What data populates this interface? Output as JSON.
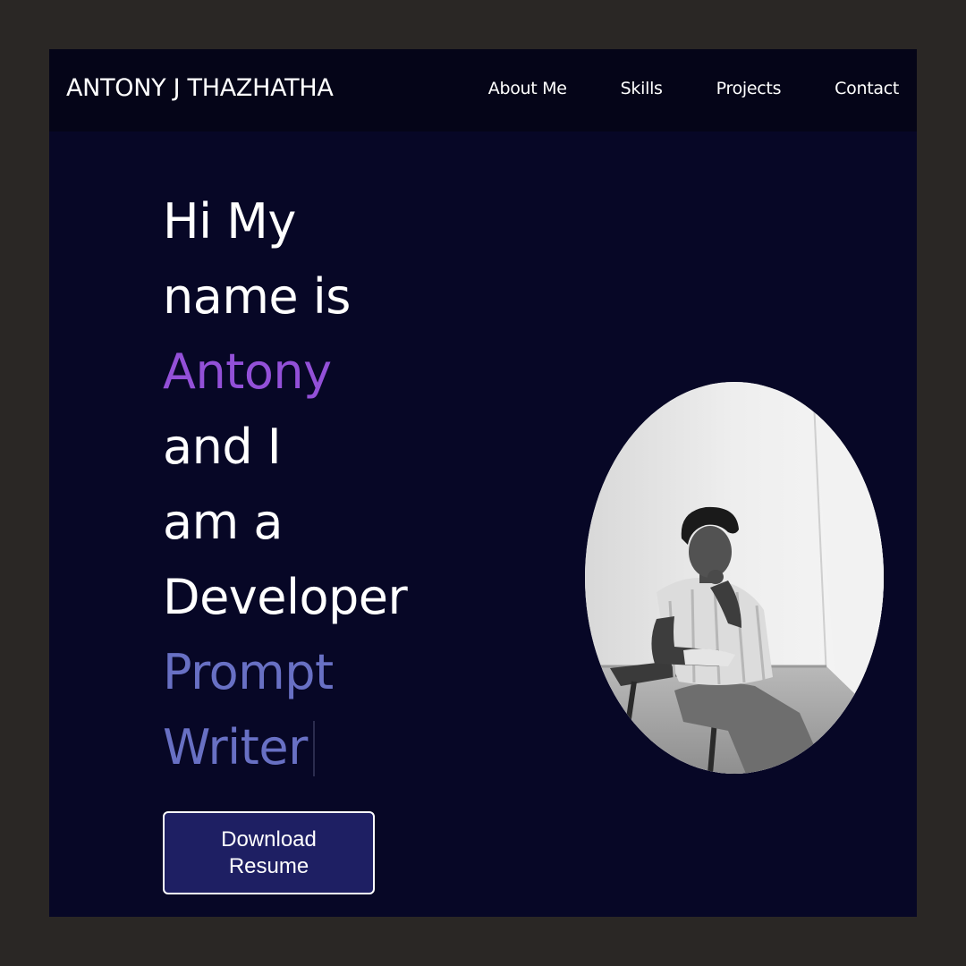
{
  "header": {
    "brand": "ANTONY J THAZHATHA",
    "nav": [
      {
        "label": "About Me"
      },
      {
        "label": "Skills"
      },
      {
        "label": "Projects"
      },
      {
        "label": "Contact"
      }
    ]
  },
  "hero": {
    "lines": [
      "Hi My",
      "name is"
    ],
    "name": "Antony",
    "lines2": [
      "and I",
      "am a",
      "Developer"
    ],
    "typed_role": [
      "Prompt",
      "Writer"
    ],
    "button_label": "Download Resume"
  },
  "colors": {
    "background": "#070726",
    "navbar": "#050518",
    "name_accent": "#9350d8",
    "typed_accent": "#6870c4",
    "button": "#1e1f63"
  },
  "photo": {
    "alt": "portrait-photo"
  }
}
